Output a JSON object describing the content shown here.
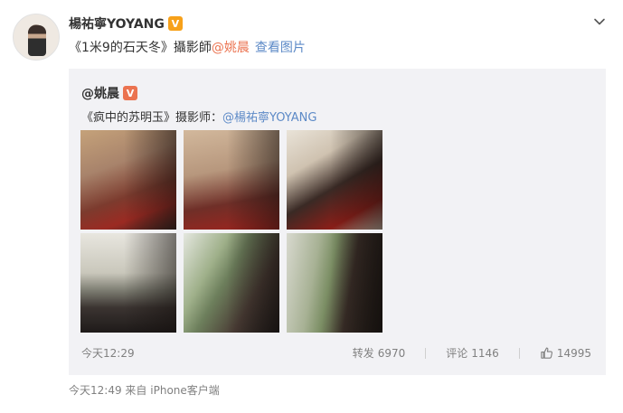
{
  "post": {
    "author": "楊祐寧YOYANG",
    "verified_mark": "V",
    "text_prefix": "《1米9的石天冬》攝影師",
    "mention": "@姚晨",
    "view_images_link": "查看图片",
    "footer": {
      "time": "今天12:49",
      "source_prefix": "来自",
      "device": "iPhone客户端"
    }
  },
  "repost": {
    "author": "@姚晨",
    "verified_mark": "V",
    "text_prefix": "《疯中的苏明玉》摄影师：",
    "mention": "@楊祐寧YOYANG",
    "time": "今天12:29",
    "stats": {
      "forward_label": "转发",
      "forward_count": "6970",
      "comment_label": "评论",
      "comment_count": "1146",
      "like_count": "14995"
    },
    "photos": [
      "photo-1",
      "photo-2",
      "photo-3",
      "photo-4",
      "photo-5",
      "photo-6"
    ]
  },
  "colors": {
    "mention_red": "#eb7350",
    "link_blue": "#5d8ac7",
    "repost_bg": "#f2f2f5",
    "muted_text": "#808080",
    "verified_orange": "#f7a11a"
  },
  "icons": {
    "more": "chevron-down-icon",
    "like": "thumbs-up-icon"
  }
}
